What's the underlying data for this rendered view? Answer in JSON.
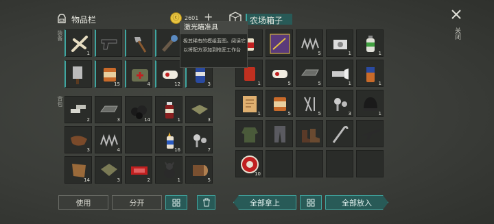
{
  "header": {
    "inventory_title": "物品栏",
    "coin_value": "2601",
    "plus_label": "+",
    "chest_title": "农场箱子",
    "close_label": "关闭"
  },
  "side_labels": {
    "equip": "装备",
    "backpack": "背包"
  },
  "tooltip": {
    "title": "激光瞄准具",
    "description": "极其稀有的模组蓝图。阅读它以将配方添加到枪匠工作台"
  },
  "inventory": {
    "equip_row1": [
      {
        "icon": "bones-icon",
        "count": "1"
      },
      {
        "icon": "pistol-icon",
        "count": ""
      },
      {
        "icon": "hatchet-icon",
        "count": ""
      },
      {
        "icon": "spiked-club-icon",
        "count": ""
      },
      {
        "icon": "empty",
        "count": ""
      }
    ],
    "equip_row2": [
      {
        "icon": "cleaver-icon",
        "count": ""
      },
      {
        "icon": "canned-food-icon",
        "count": "15"
      },
      {
        "icon": "first-aid-bag-icon",
        "count": "4"
      },
      {
        "icon": "bandage-icon",
        "count": "12"
      },
      {
        "icon": "soda-can-icon",
        "count": "3"
      }
    ],
    "backpack": [
      {
        "icon": "metal-bars-icon",
        "count": "2"
      },
      {
        "icon": "iron-ingot-icon",
        "count": "3"
      },
      {
        "icon": "coal-icon",
        "count": "14"
      },
      {
        "icon": "medicine-bottle-icon",
        "count": "1"
      },
      {
        "icon": "cloth-icon",
        "count": "3"
      },
      {
        "icon": "leather-icon",
        "count": "3"
      },
      {
        "icon": "spring-icon",
        "count": "4"
      },
      {
        "icon": "empty",
        "count": ""
      },
      {
        "icon": "glue-icon",
        "count": "16"
      },
      {
        "icon": "screws-icon",
        "count": "7"
      },
      {
        "icon": "hide-icon",
        "count": "14"
      },
      {
        "icon": "fabric-icon",
        "count": "3"
      },
      {
        "icon": "ticket-icon",
        "count": "2"
      },
      {
        "icon": "dog-figure-icon",
        "count": "1"
      },
      {
        "icon": "log-icon",
        "count": "5"
      }
    ]
  },
  "chest": {
    "items": [
      {
        "icon": "cocktail-icon",
        "count": ""
      },
      {
        "icon": "blueprint-icon",
        "count": ""
      },
      {
        "icon": "spring-icon",
        "count": "5"
      },
      {
        "icon": "engine-part-icon",
        "count": "1"
      },
      {
        "icon": "spray-can-icon",
        "count": "1"
      },
      {
        "icon": "red-can-icon",
        "count": "1"
      },
      {
        "icon": "bandage-icon",
        "count": "5"
      },
      {
        "icon": "iron-ingot-icon",
        "count": "5"
      },
      {
        "icon": "flashlight-icon",
        "count": "1"
      },
      {
        "icon": "battery-icon",
        "count": "1"
      },
      {
        "icon": "recipe-book-icon",
        "count": "1"
      },
      {
        "icon": "canned-food-icon",
        "count": "5"
      },
      {
        "icon": "nails-icon",
        "count": "5"
      },
      {
        "icon": "screws-icon",
        "count": "3"
      },
      {
        "icon": "beanie-icon",
        "count": "1"
      },
      {
        "icon": "jacket-icon",
        "count": ""
      },
      {
        "icon": "pants-icon",
        "count": ""
      },
      {
        "icon": "boots-icon",
        "count": ""
      },
      {
        "icon": "crowbar-icon",
        "count": ""
      },
      {
        "icon": "rifle-icon",
        "count": ""
      },
      {
        "icon": "bottle-cap-icon",
        "count": "10"
      },
      {
        "icon": "empty",
        "count": ""
      },
      {
        "icon": "empty",
        "count": ""
      },
      {
        "icon": "empty",
        "count": ""
      },
      {
        "icon": "empty",
        "count": ""
      }
    ]
  },
  "buttons": {
    "use": "使用",
    "split": "分开",
    "take_all": "全部拿上",
    "put_all": "全部放入"
  },
  "colors": {
    "accent_teal": "#3fa6a0",
    "coin_gold": "#e8c440",
    "tooltip_bg": "#262825"
  }
}
